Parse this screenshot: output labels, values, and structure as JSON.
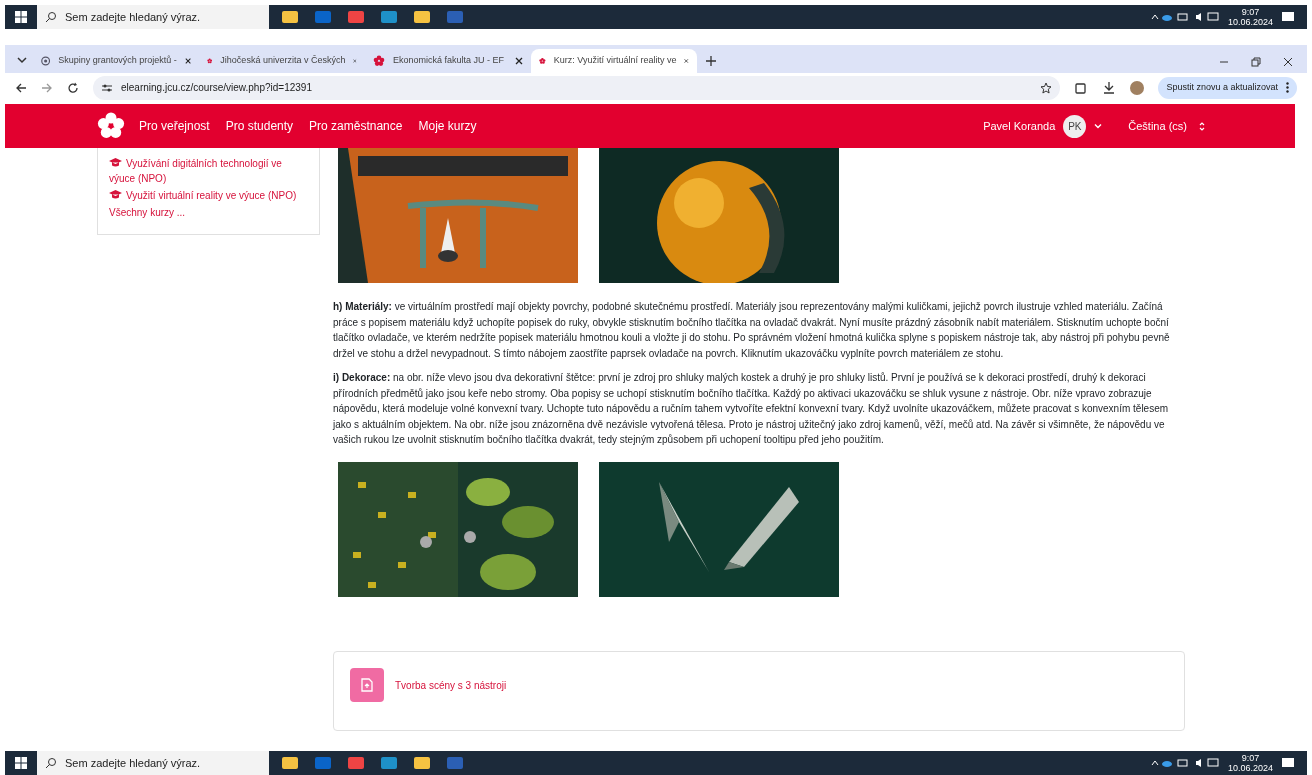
{
  "taskbar_top": {
    "search_placeholder": "Sem zadejte hledaný výraz.",
    "time": "9:07",
    "date": "10.06.2024"
  },
  "browser": {
    "tabs": [
      {
        "title": "Skupiny grantových projektů - ",
        "selected": false,
        "kind": "globe"
      },
      {
        "title": "Jihočeská univerzita v Českých ",
        "selected": false,
        "kind": "flower"
      },
      {
        "title": "Ekonomická fakulta JU - EF",
        "selected": false,
        "kind": "flower"
      },
      {
        "title": "Kurz: Využití virtuální reality ve ",
        "selected": true,
        "kind": "flower"
      }
    ],
    "url": "elearning.jcu.cz/course/view.php?id=12391",
    "update_button": "Spustit znovu a aktualizovat"
  },
  "navbar": {
    "links": [
      "Pro veřejnost",
      "Pro studenty",
      "Pro zaměstnance",
      "Moje kurzy"
    ],
    "user_name": "Pavel Koranda",
    "user_initials": "PK",
    "language": "Čeština (cs)"
  },
  "sidebar": {
    "courses": [
      "Využívání digitálních technologií ve výuce (NPO)",
      "Využití virtuální reality ve výuce (NPO)"
    ],
    "all_courses_link": "Všechny kurzy ..."
  },
  "sections": [
    {
      "heading": "h) Materiály:",
      "text": "ve virtuálním prostředí mají objekty povrchy, podobné skutečnému prostředí. Materiály jsou reprezentovány malými kuličkami, jejichž povrch ilustruje vzhled materiálu. Začíná práce s popisem materiálu když uchopíte popisek do ruky, obvykle stisknutím bočního tlačítka na ovladač dvakrát. Nyní musíte prázdný zásobník nabít materiálem. Stisknutím uchopte boční tlačítko ovladače, ve kterém nedržíte popisek materiálu hmotnou kouli a vložte ji do stohu. Po správném vložení hmotná kulička splyne s popiskem nástroje tak, aby nástroj při pohybu pevně držel ve stohu a držel nevypadnout. S tímto nábojem zaostříte paprsek ovladače na povrch. Kliknutím ukazováčku vyplníte povrch materiálem ze stohu."
    },
    {
      "heading": "i) Dekorace:",
      "text": "na obr. níže vlevo jsou dva dekorativní štětce: první je zdroj pro shluky malých kostek a druhý je pro shluky listů. První je používá se k dekoraci prostředí, druhý k dekoraci přírodních předmětů jako jsou keře nebo stromy. Oba popisy se uchopí stisknutím bočního tlačítka. Každý po aktivaci ukazováčku se shluk vysune z nástroje. Obr. níže vpravo zobrazuje nápovědu, která modeluje volné konvexní tvary. Uchopte tuto nápovědu a ručním tahem vytvoříte efektní konvexní tvary. Když uvolníte ukazováčkem, můžete pracovat s konvexním tělesem jako s aktuálním objektem. Na obr. níže jsou znázorněna dvě nezávisle vytvořená tělesa. Proto je nástroj užitečný jako zdroj kamenů, věží, mečů atd. Na závěr si všimněte, že nápovědu ve vašich rukou lze uvolnit stisknutím bočního tlačítka dvakrát, tedy stejným způsobem při uchopení tooltipu před jeho použitím."
    }
  ],
  "activity": {
    "title": "Tvorba scény s 3 nástroji"
  },
  "taskbar_bottom": {
    "search_placeholder": "Sem zadejte hledaný výraz.",
    "time": "9:07",
    "date": "10.06.2024"
  }
}
